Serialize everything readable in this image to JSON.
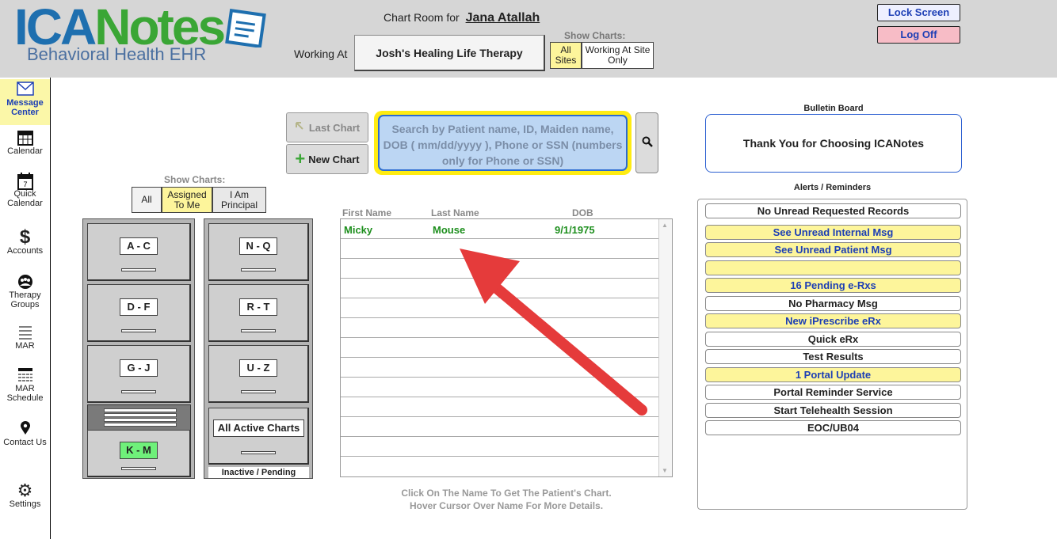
{
  "brand": {
    "name_part1": "ICA",
    "name_part2": "Notes",
    "tagline": "Behavioral Health EHR"
  },
  "header": {
    "chart_room_label": "Chart Room for",
    "user_name": "Jana Atallah",
    "working_at_label": "Working At",
    "site_name": "Josh's Healing Life Therapy",
    "show_charts_label": "Show Charts:",
    "show_all_label": "All Sites",
    "show_site_label": "Working At Site Only",
    "lock_screen_label": "Lock Screen",
    "log_off_label": "Log Off"
  },
  "sidebar": {
    "items": [
      {
        "label": "Message Center",
        "icon": "envelope-icon"
      },
      {
        "label": "Calendar",
        "icon": "calendar-icon"
      },
      {
        "label": "Quick Calendar",
        "icon": "quick-calendar-icon",
        "badge": "7"
      },
      {
        "label": "Accounts",
        "icon": "dollar-icon"
      },
      {
        "label": "Therapy Groups",
        "icon": "group-icon"
      },
      {
        "label": "MAR",
        "icon": "list-icon"
      },
      {
        "label": "MAR Schedule",
        "icon": "schedule-icon"
      },
      {
        "label": "Contact Us",
        "icon": "location-pin-icon"
      },
      {
        "label": "Settings",
        "icon": "gear-icon"
      }
    ]
  },
  "search": {
    "last_chart_label": "Last Chart",
    "new_chart_label": "New Chart",
    "placeholder": "Search by Patient name, ID, Maiden name, DOB ( mm/dd/yyyy ), Phone or SSN (numbers only for Phone or SSN)"
  },
  "show_charts": {
    "label": "Show Charts:",
    "all_label": "All",
    "assigned_label": "Assigned To Me",
    "principal_label": "I Am Principal"
  },
  "cabinets": {
    "left": [
      "A - C",
      "D - F",
      "G - J",
      "K - M"
    ],
    "right": [
      "N - Q",
      "R - T",
      "U - Z"
    ],
    "all_active_label": "All Active Charts",
    "inactive_label": "Inactive / Pending"
  },
  "patient_list": {
    "headers": {
      "first": "First Name",
      "last": "Last Name",
      "dob": "DOB"
    },
    "rows": [
      {
        "first": "Micky",
        "last": "Mouse",
        "dob": "9/1/1975"
      }
    ],
    "help_line1": "Click On The Name To Get The Patient's Chart.",
    "help_line2": "Hover Cursor Over Name For More Details."
  },
  "bulletin": {
    "title": "Bulletin Board",
    "message": "Thank You for Choosing ICANotes"
  },
  "alerts": {
    "title": "Alerts / Reminders",
    "items": [
      {
        "label": "No Unread Requested Records",
        "style": "white"
      },
      {
        "label": "See Unread Internal Msg",
        "style": "yellow"
      },
      {
        "label": "See Unread Patient Msg",
        "style": "yellow"
      },
      {
        "label": "",
        "style": "yellow"
      },
      {
        "label": "16 Pending e-Rxs",
        "style": "yellow"
      },
      {
        "label": "No Pharmacy Msg",
        "style": "white"
      },
      {
        "label": "New iPrescribe eRx",
        "style": "yellow"
      },
      {
        "label": "Quick eRx",
        "style": "white"
      },
      {
        "label": "Test Results",
        "style": "white"
      },
      {
        "label": "1 Portal Update",
        "style": "yellow"
      },
      {
        "label": "Portal Reminder Service",
        "style": "white"
      },
      {
        "label": "Start Telehealth Session",
        "style": "white"
      },
      {
        "label": "EOC/UB04",
        "style": "white"
      }
    ]
  },
  "colors": {
    "header_bg": "#d6d6d6",
    "highlight_yellow": "#fdf59b",
    "link_blue": "#1d3fb5",
    "patient_green": "#1e8f1e",
    "active_drawer_green": "#6ff07a",
    "arrow_red": "#e53b3b"
  }
}
